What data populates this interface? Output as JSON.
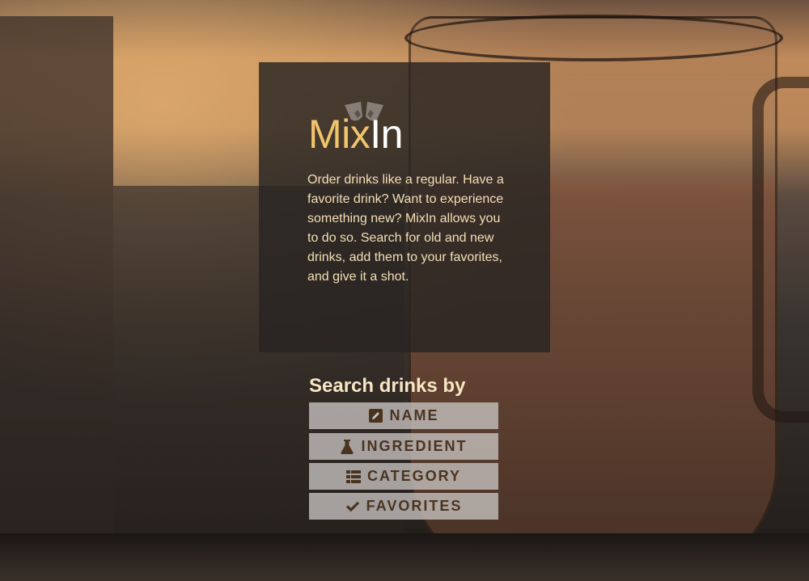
{
  "brand": {
    "title_part_a": "Mix",
    "title_part_b": "In",
    "accent_color": "#f0c46b",
    "logo_icon": "cocktail-glasses-icon"
  },
  "intro": {
    "description": "Order drinks like a regular. Have a favorite drink? Want to experience something new? MixIn allows you to do so. Search for old and new drinks, add them to your favorites, and give it a shot."
  },
  "search": {
    "heading": "Search drinks by",
    "buttons": [
      {
        "label": "NAME",
        "icon": "edit-icon"
      },
      {
        "label": "INGREDIENT",
        "icon": "flask-icon"
      },
      {
        "label": "CATEGORY",
        "icon": "list-icon"
      },
      {
        "label": "FAVORITES",
        "icon": "check-icon"
      }
    ]
  }
}
